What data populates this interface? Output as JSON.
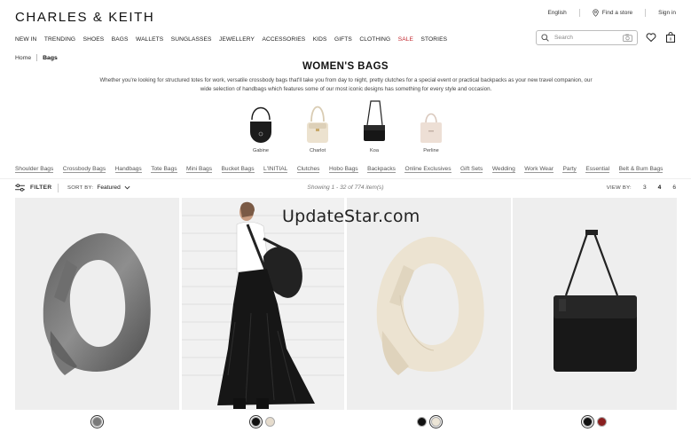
{
  "brand": {
    "logo": "CHARLES & KEITH"
  },
  "utility": {
    "language": "English",
    "find_store": "Find a store",
    "sign_in": "Sign in"
  },
  "nav": [
    "NEW IN",
    "TRENDING",
    "SHOES",
    "BAGS",
    "WALLETS",
    "SUNGLASSES",
    "JEWELLERY",
    "ACCESSORIES",
    "KIDS",
    "GIFTS",
    "CLOTHING",
    "SALE",
    "STORIES"
  ],
  "search": {
    "placeholder": "Search"
  },
  "breadcrumb": {
    "home": "Home",
    "current": "Bags"
  },
  "page": {
    "title": "WOMEN'S BAGS",
    "description": "Whether you're looking for structured totes for work, versatile crossbody bags that'll take you from day to night, pretty clutches for a special event or practical backpacks as your new travel companion, our wide selection of handbags which features some of our most iconic designs has something for every style and occasion."
  },
  "featured": [
    {
      "name": "Gabine",
      "color": "#1a1a1a"
    },
    {
      "name": "Charlot",
      "color": "#e9dfcc"
    },
    {
      "name": "Koa",
      "color": "#161616"
    },
    {
      "name": "Perline",
      "color": "#eadbd0"
    }
  ],
  "subcategories": [
    "Shoulder Bags",
    "Crossbody Bags",
    "Handbags",
    "Tote Bags",
    "Mini Bags",
    "Bucket Bags",
    "L'INITIAL",
    "Clutches",
    "Hobo Bags",
    "Backpacks",
    "Online Exclusives",
    "Gift Sets",
    "Wedding",
    "Work Wear",
    "Party",
    "Essential",
    "Belt & Bum Bags"
  ],
  "toolbar": {
    "filter": "FILTER",
    "sort_label": "SORT BY:",
    "sort_value": "Featured",
    "showing": "Showing 1 - 32 of 774 item(s)",
    "view_label": "VIEW BY:",
    "view_options": [
      "3",
      "4",
      "6"
    ],
    "view_selected": "4"
  },
  "watermark": "UpdateStar.com",
  "products": [
    {
      "swatches": [
        "#7a7a7a"
      ]
    },
    {
      "swatches": [
        "#111111",
        "#e6dccd"
      ]
    },
    {
      "swatches": [
        "#111111",
        "#ece5d6"
      ]
    },
    {
      "swatches": [
        "#111111",
        "#8a1f1f"
      ]
    }
  ]
}
